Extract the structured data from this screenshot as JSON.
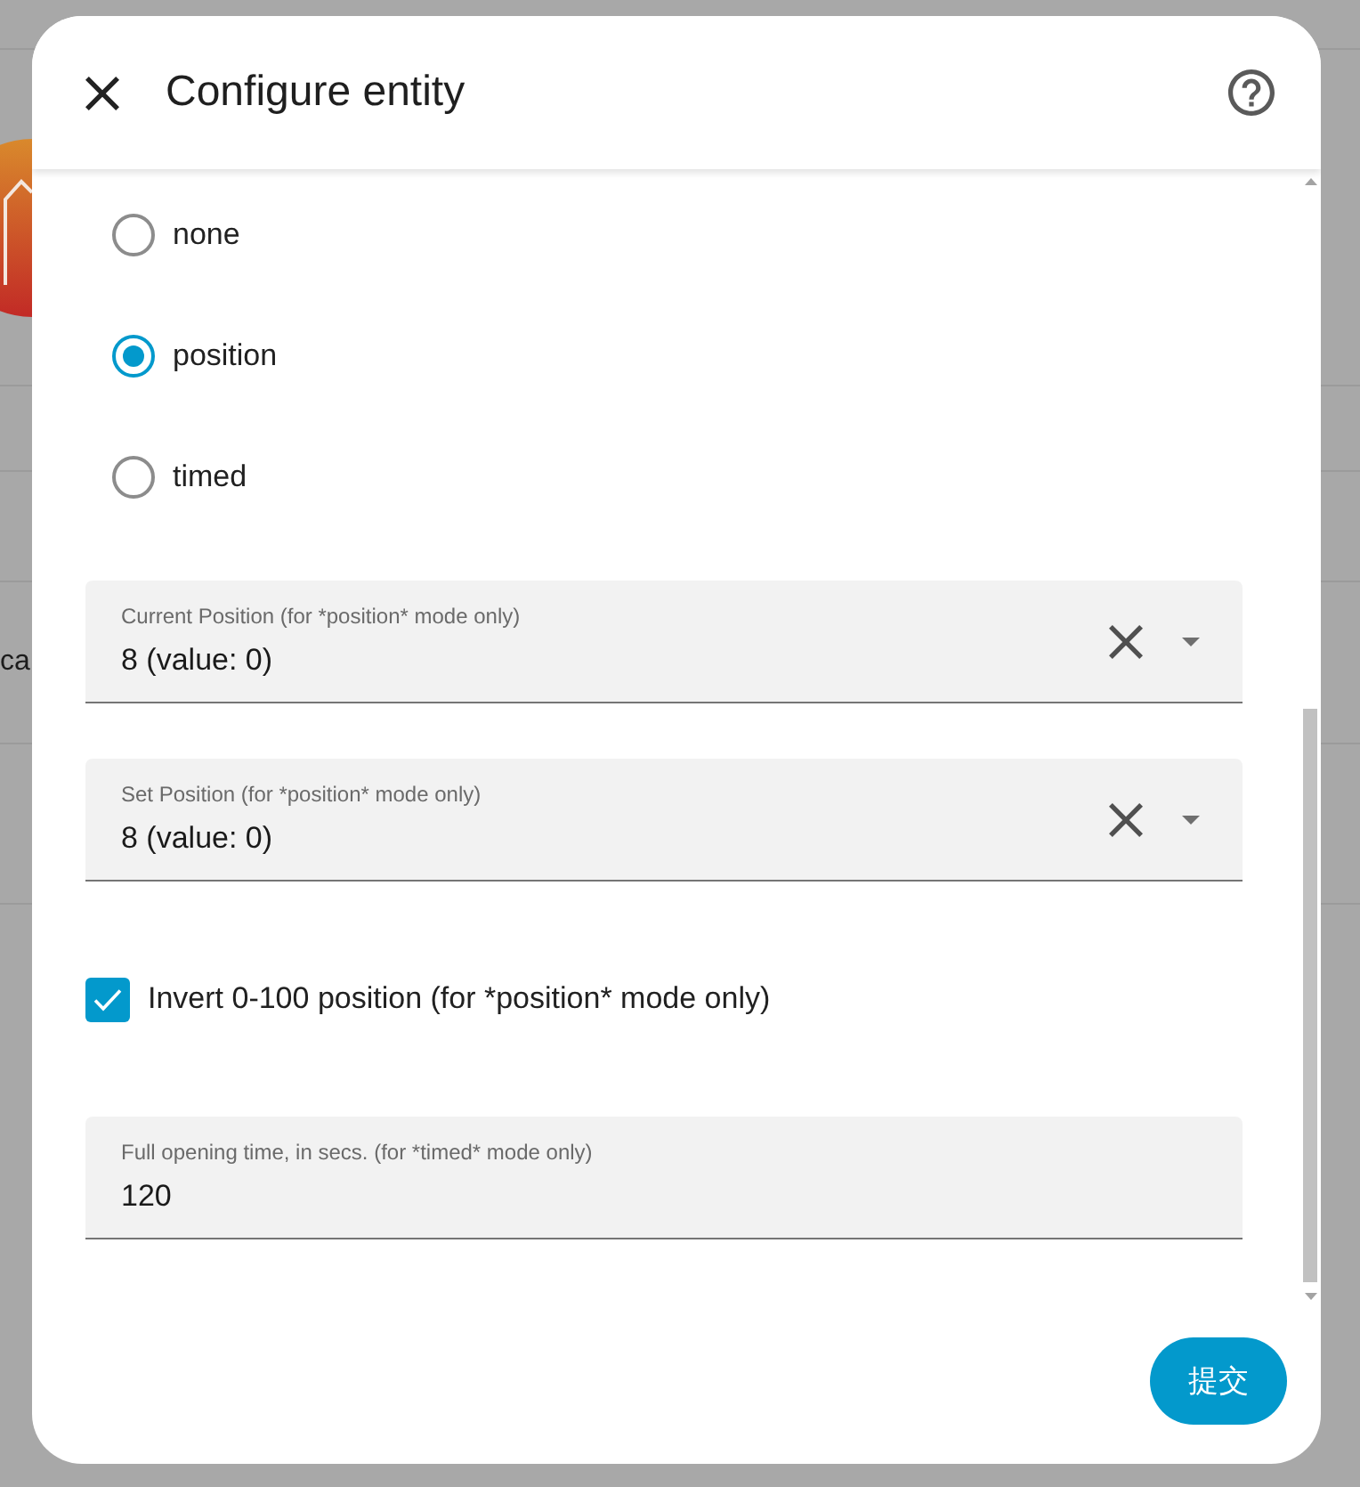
{
  "background_page": {
    "text_fragment": "ca"
  },
  "dialog": {
    "title": "Configure entity"
  },
  "mode_options": [
    {
      "label": "none",
      "selected": false
    },
    {
      "label": "position",
      "selected": true
    },
    {
      "label": "timed",
      "selected": false
    }
  ],
  "form_items": [
    {
      "kind": "select",
      "label": "Current Position (for *position* mode only)",
      "value": "8 (value: 0)"
    },
    {
      "kind": "select",
      "label": "Set Position (for *position* mode only)",
      "value": "8 (value: 0)"
    },
    {
      "kind": "checkbox",
      "label": "Invert 0-100 position (for *position* mode only)",
      "checked": true
    },
    {
      "kind": "text",
      "label": "Full opening time, in secs. (for *timed* mode only)",
      "value": "120"
    }
  ],
  "submit_button": {
    "label": "提交"
  }
}
